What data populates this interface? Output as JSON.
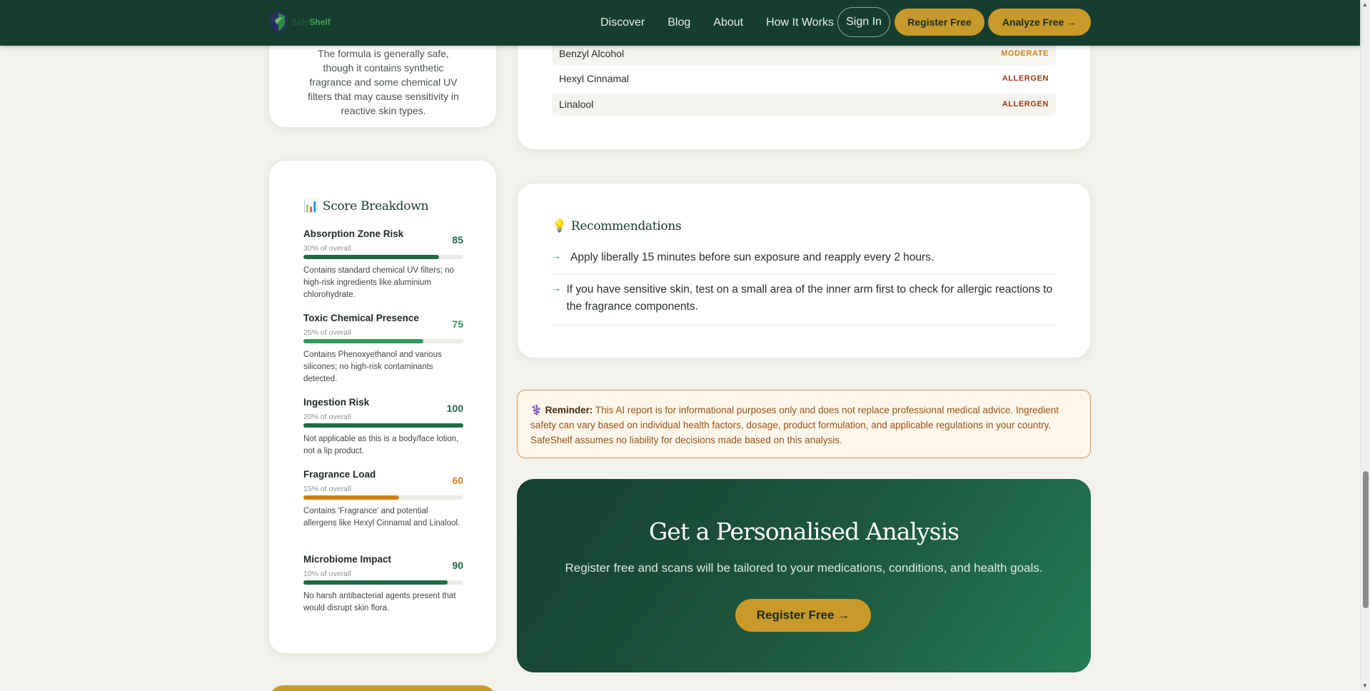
{
  "header": {
    "logo": {
      "part1": "Safe",
      "part2": "Shelf"
    },
    "nav": [
      "Discover",
      "Blog",
      "About",
      "How It Works"
    ],
    "sign_in": "Sign In",
    "register": "Register Free",
    "analyze": "Analyze Free →"
  },
  "summary": {
    "text": "The formula is generally safe, though it contains synthetic fragrance and some chemical UV filters that may cause sensitivity in reactive skin types."
  },
  "ingredients": [
    {
      "name": "Benzyl Alcohol",
      "tag": "MODERATE"
    },
    {
      "name": "Hexyl Cinnamal",
      "tag": "ALLERGEN"
    },
    {
      "name": "Linalool",
      "tag": "ALLERGEN"
    }
  ],
  "score_breakdown": {
    "icon": "📊",
    "title": "Score Breakdown",
    "items": [
      {
        "name": "Absorption Zone Risk",
        "value": 85,
        "display": "85",
        "weight": "30% of overall",
        "color": "#1e6b46",
        "desc": "Contains standard chemical UV filters; no high-risk ingredients like aluminium chlorohydrate."
      },
      {
        "name": "Toxic Chemical Presence",
        "value": 75,
        "display": "75",
        "weight": "25% of overall",
        "color": "#2f9a5c",
        "desc": "Contains Phenoxyethanol and various silicones; no high-risk contaminants detected."
      },
      {
        "name": "Ingestion Risk",
        "value": 100,
        "display": "100",
        "weight": "20% of overall",
        "color": "#1e6b46",
        "desc": "Not applicable as this is a body/face lotion, not a lip product."
      },
      {
        "name": "Fragrance Load",
        "value": 60,
        "display": "60",
        "weight": "15% of overall",
        "color": "#d67e14",
        "desc": "Contains 'Fragrance' and potential allergens like Hexyl Cinnamal and Linalool."
      },
      {
        "name": "Microbiome Impact",
        "value": 90,
        "display": "90",
        "weight": "10% of overall",
        "color": "#1e6b46",
        "desc": "No harsh antibacterial agents present that would disrupt skin flora."
      }
    ]
  },
  "recommendations": {
    "icon": "💡",
    "title": "Recommendations",
    "items": [
      "Apply liberally 15 minutes before sun exposure and reapply every 2 hours.",
      "If you have sensitive skin, test on a small area of the inner arm first to check for allergic reactions to the fragrance components."
    ]
  },
  "reminder": {
    "icon": "⚕️",
    "label": "Reminder:",
    "text": "This AI report is for informational purposes only and does not replace professional medical advice. Ingredient safety can vary based on individual health factors, dosage, product formulation, and applicable regulations in your country. SafeShelf assumes no liability for decisions made based on this analysis."
  },
  "cta": {
    "title": "Get a Personalised Analysis",
    "subtitle": "Register free and scans will be tailored to your medications, conditions, and health goals.",
    "button": "Register Free →"
  },
  "colors": {
    "header_bg": "#153e2e",
    "accent_gold": "#c89a2b",
    "moderate": "#d1831a",
    "allergen": "#9a3b16"
  }
}
